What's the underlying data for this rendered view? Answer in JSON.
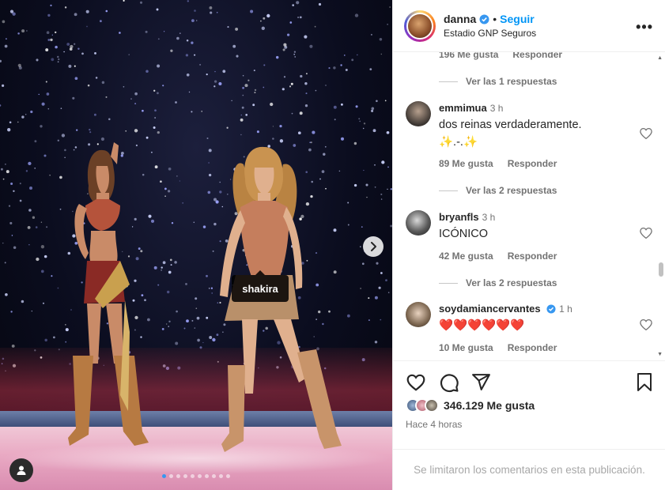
{
  "header": {
    "username": "danna",
    "follow_label": "Seguir",
    "location": "Estadio GNP Seguros",
    "more_label": "•••"
  },
  "media": {
    "tag_label": "shakira",
    "carousel_dots": 10,
    "active_dot": 0
  },
  "comments": {
    "top_meta": {
      "likes": "196 Me gusta",
      "reply": "Responder"
    },
    "top_replies": "Ver las 1 respuestas",
    "items": [
      {
        "user": "emmimua",
        "time": "3 h",
        "text": "dos reinas verdaderamente.",
        "text2": "✨.-.✨",
        "likes": "89 Me gusta",
        "reply": "Responder",
        "view_replies": "Ver las 2 respuestas"
      },
      {
        "user": "bryanfls",
        "time": "3 h",
        "text": "ICÓNICO",
        "likes": "42 Me gusta",
        "reply": "Responder",
        "view_replies": "Ver las 2 respuestas"
      },
      {
        "user": "soydamiancervantes",
        "time": "1 h",
        "text": "❤️❤️❤️❤️❤️❤️",
        "likes": "10 Me gusta",
        "reply": "Responder"
      }
    ]
  },
  "footer": {
    "likes_count": "346.129 Me gusta",
    "time_ago": "Hace 4 horas",
    "comments_limited": "Se limitaron los comentarios en esta publicación."
  },
  "colors": {
    "accent": "#0095f6",
    "verified": "#3797f0",
    "heart": "#ed1c3b"
  }
}
